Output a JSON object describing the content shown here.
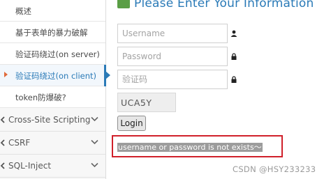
{
  "sidebar": {
    "sub_items": [
      {
        "label": "概述"
      },
      {
        "label": "基于表单的暴力破解"
      },
      {
        "label": "验证码绕过(on server)"
      },
      {
        "label": "验证码绕过(on client)"
      },
      {
        "label": "token防爆破?"
      }
    ],
    "active_index": 3,
    "groups": [
      {
        "label": "Cross-Site Scripting"
      },
      {
        "label": "CSRF"
      },
      {
        "label": "SQL-Inject"
      }
    ]
  },
  "main": {
    "title": "Please Enter Your Information",
    "username_placeholder": "Username",
    "password_placeholder": "Password",
    "captcha_placeholder": "验证码",
    "captcha_code": "UCA5Y",
    "login_label": "Login",
    "error_message": "username or password is not exists～"
  },
  "watermark": "CSDN @HSY233233",
  "icons": {
    "header": "book-icon",
    "username": "user-icon",
    "password": "lock-icon",
    "captcha": "lock-icon",
    "groups": "code-icon",
    "chevron": "chevron-down-icon"
  },
  "colors": {
    "accent": "#2a7ab7",
    "error_border": "#d0202a",
    "active_arrow": "#e06a3b",
    "header_icon": "#5a9e45"
  }
}
